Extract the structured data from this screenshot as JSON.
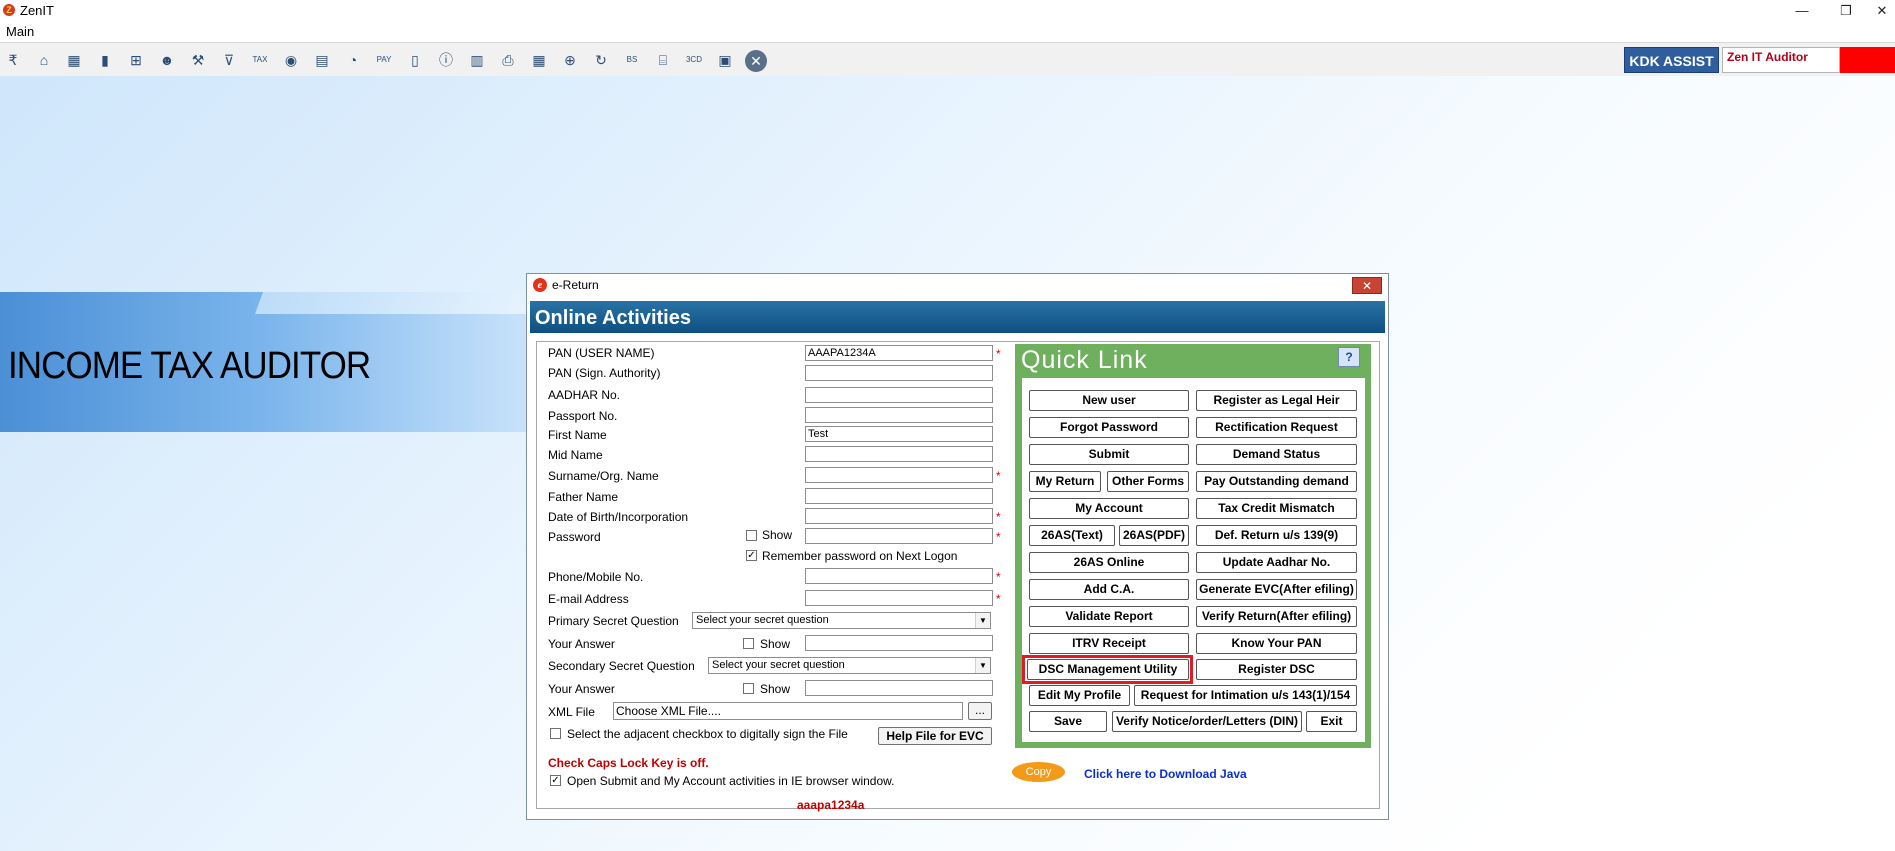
{
  "app": {
    "title": "ZenIT"
  },
  "menu": {
    "main": "Main"
  },
  "window_controls": {
    "minimize": "—",
    "restore": "❐",
    "close": "✕"
  },
  "toolbar": {
    "kdk_assist": "KDK ASSIST",
    "zen_it_auditor": "Zen IT Auditor",
    "icons": [
      "rupee-icon",
      "home-icon",
      "building-icon",
      "bar-chart-icon",
      "gift-icon",
      "users-icon",
      "gavel-icon",
      "filter-icon",
      "tax-icon",
      "audio-icon",
      "calculator-icon",
      "pie-chart-icon",
      "pay-icon",
      "book-icon",
      "info-icon",
      "ledger-icon",
      "document-search-icon",
      "calendar-icon",
      "add-document-icon",
      "refresh-icon",
      "bs-icon",
      "bank-icon",
      "3cd-icon",
      "register-icon",
      "close-circle-icon"
    ]
  },
  "banner": {
    "text": "INCOME TAX AUDITOR"
  },
  "dialog": {
    "title": "e-Return",
    "close": "✕",
    "header": "Online Activities",
    "fields": {
      "pan_user_label": "PAN (USER NAME)",
      "pan_user_value": "AAAPA1234A",
      "pan_sign_label": "PAN (Sign. Authority)",
      "aadhar_label": "AADHAR No.",
      "passport_label": "Passport No.",
      "first_name_label": "First Name",
      "first_name_value": "Test",
      "mid_name_label": "Mid Name",
      "surname_label": "Surname/Org. Name",
      "father_label": "Father Name",
      "dob_label": "Date of Birth/Incorporation",
      "password_label": "Password",
      "show": "Show",
      "remember": "Remember password on Next Logon",
      "phone_label": "Phone/Mobile No.",
      "email_label": "E-mail Address",
      "primary_q_label": "Primary Secret Question",
      "secondary_q_label": "Secondary Secret Question",
      "select_placeholder": "Select your secret question",
      "answer_label": "Your Answer",
      "xml_label": "XML File",
      "xml_value": "Choose XML File....",
      "browse": "...",
      "digital_sign": "Select the adjacent checkbox to digitally sign the File",
      "help_evc": "Help File for EVC",
      "caps": "Check Caps Lock Key is off.",
      "open_ie": "Open Submit and My Account activities in IE browser window.",
      "pan_lower": "aaapa1234a",
      "required": "*"
    },
    "quick_link": {
      "title": "Quick Link",
      "help": "?",
      "buttons": {
        "new_user": "New user",
        "legal_heir": "Register as Legal Heir",
        "forgot": "Forgot Password",
        "rectification": "Rectification Request",
        "submit": "Submit",
        "demand_status": "Demand Status",
        "my_return": "My Return",
        "other_forms": "Other Forms",
        "pay_outstanding": "Pay Outstanding demand",
        "my_account": "My Account",
        "tax_credit": "Tax Credit Mismatch",
        "as26_text": "26AS(Text)",
        "as26_pdf": "26AS(PDF)",
        "def_return": "Def. Return u/s 139(9)",
        "as26_online": "26AS Online",
        "update_aadhar": "Update Aadhar No.",
        "add_ca": "Add C.A.",
        "gen_evc": "Generate EVC(After efiling)",
        "validate": "Validate Report",
        "verify_return": "Verify Return(After efiling)",
        "itrv": "ITRV Receipt",
        "know_pan": "Know Your PAN",
        "dsc_util": "DSC Management Utility",
        "register_dsc": "Register DSC",
        "edit_profile": "Edit My Profile",
        "intimation": "Request for Intimation u/s 143(1)/154",
        "save": "Save",
        "verify_notice": "Verify Notice/order/Letters (DIN)",
        "exit": "Exit"
      }
    },
    "copy": "Copy",
    "java": "Click here to Download Java"
  }
}
